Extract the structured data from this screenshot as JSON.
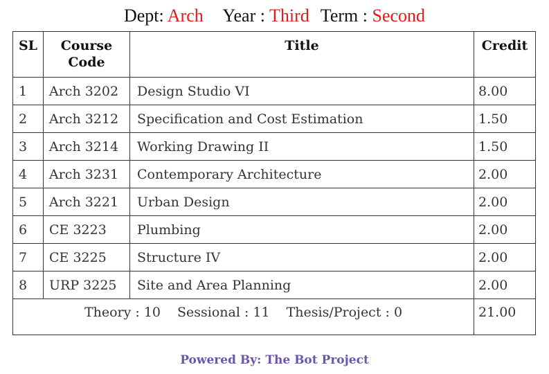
{
  "heading": {
    "dept_label": "Dept:",
    "dept_value": "Arch",
    "year_label": "Year :",
    "year_value": "Third",
    "term_label": "Term :",
    "term_value": "Second"
  },
  "table": {
    "headers": {
      "sl": "SL",
      "course_code_line1": "Course",
      "course_code_line2": "Code",
      "title": "Title",
      "credit": "Credit"
    },
    "rows": [
      {
        "sl": "1",
        "code": "Arch 3202",
        "title": "Design Studio VI",
        "credit": "8.00"
      },
      {
        "sl": "2",
        "code": "Arch 3212",
        "title": "Specification and Cost Estimation",
        "credit": "1.50"
      },
      {
        "sl": "3",
        "code": "Arch 3214",
        "title": "Working Drawing II",
        "credit": "1.50"
      },
      {
        "sl": "4",
        "code": "Arch 3231",
        "title": "Contemporary Architecture",
        "credit": "2.00"
      },
      {
        "sl": "5",
        "code": "Arch 3221",
        "title": "Urban Design",
        "credit": "2.00"
      },
      {
        "sl": "6",
        "code": "CE 3223",
        "title": "Plumbing",
        "credit": "2.00"
      },
      {
        "sl": "7",
        "code": "CE 3225",
        "title": "Structure IV",
        "credit": "2.00"
      },
      {
        "sl": "8",
        "code": "URP 3225",
        "title": "Site and Area Planning",
        "credit": "2.00"
      }
    ],
    "summary": {
      "theory": "Theory : 10",
      "sessional": "Sessional : 11",
      "thesis": "Thesis/Project : 0",
      "total_credit": "21.00"
    }
  },
  "footer": {
    "text": "Powered By: The Bot Project"
  },
  "colors": {
    "value_red": "#e01b1b",
    "footer_purple": "#6a56a8",
    "border": "#333333"
  }
}
